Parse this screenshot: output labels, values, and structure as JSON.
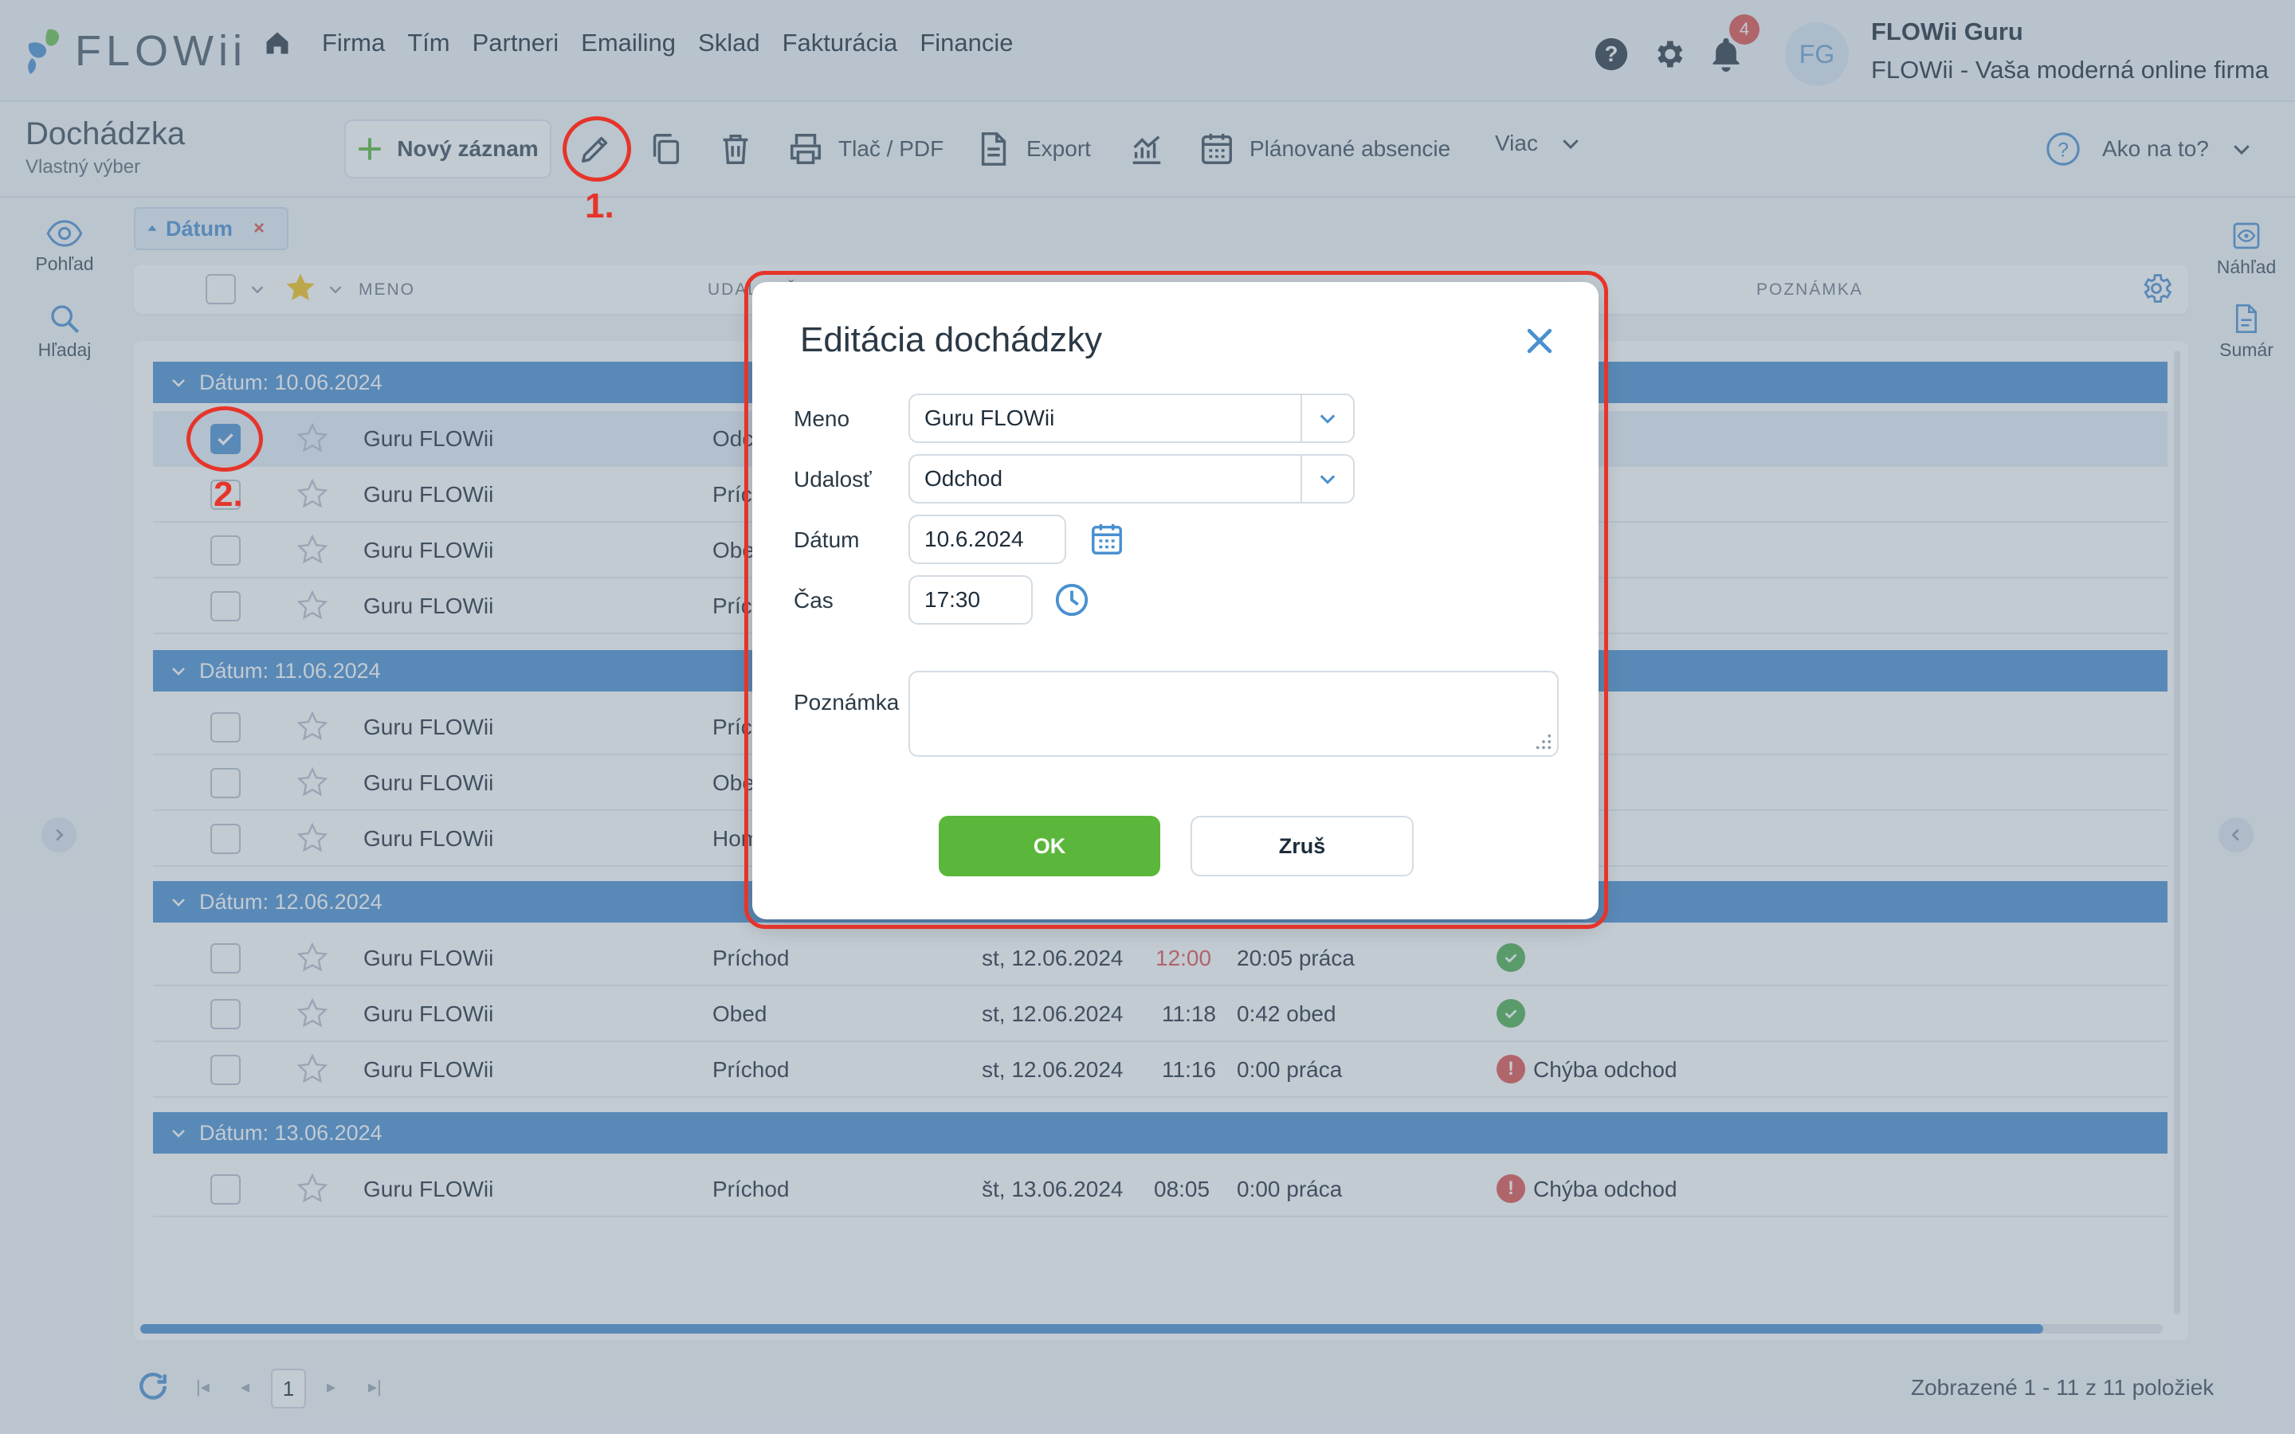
{
  "brand": {
    "logo_text": "FLOWii"
  },
  "nav": {
    "items": [
      "Firma",
      "Tím",
      "Partneri",
      "Emailing",
      "Sklad",
      "Fakturácia",
      "Financie"
    ]
  },
  "user": {
    "notifications": "4",
    "initials": "FG",
    "name": "FLOWii Guru",
    "company": "FLOWii - Vaša moderná online firma"
  },
  "page": {
    "title": "Dochádzka",
    "subtitle": "Vlastný výber"
  },
  "toolbar": {
    "new_record": "Nový záznam",
    "print": "Tlač / PDF",
    "export": "Export",
    "planned_absences": "Plánované absencie",
    "more": "Viac",
    "howto": "Ako na to?"
  },
  "rail_left": {
    "view": "Pohľad",
    "search": "Hľadaj"
  },
  "rail_right": {
    "preview": "Náhľad",
    "summary": "Sumár"
  },
  "filter_chip": {
    "label": "Dátum"
  },
  "table_header": {
    "name": "MENO",
    "event": "UDALOSŤ",
    "note": "POZNÁMKA"
  },
  "groups": [
    {
      "label": "Dátum: 10.06.2024",
      "rows": [
        {
          "name": "Guru FLOWii",
          "event": "Odchod",
          "selected": true
        },
        {
          "name": "Guru FLOWii",
          "event": "Príchod"
        },
        {
          "name": "Guru FLOWii",
          "event": "Obed"
        },
        {
          "name": "Guru FLOWii",
          "event": "Príchod"
        }
      ]
    },
    {
      "label": "Dátum: 11.06.2024",
      "rows": [
        {
          "name": "Guru FLOWii",
          "event": "Príchod"
        },
        {
          "name": "Guru FLOWii",
          "event": "Obed"
        },
        {
          "name": "Guru FLOWii",
          "event": "Home office"
        }
      ]
    },
    {
      "label": "Dátum: 12.06.2024",
      "rows": [
        {
          "name": "Guru FLOWii",
          "event": "Príchod",
          "date": "st, 12.06.2024",
          "time": "12:00",
          "duration": "20:05 práca",
          "status": "ok",
          "time_color": "#e0524d"
        },
        {
          "name": "Guru FLOWii",
          "event": "Obed",
          "date": "st, 12.06.2024",
          "time": "11:18",
          "duration": "0:42 obed",
          "status": "ok"
        },
        {
          "name": "Guru FLOWii",
          "event": "Príchod",
          "date": "st, 12.06.2024",
          "time": "11:16",
          "duration": "0:00 práca",
          "status": "error",
          "note": "Chýba odchod"
        }
      ]
    },
    {
      "label": "Dátum: 13.06.2024",
      "rows": [
        {
          "name": "Guru FLOWii",
          "event": "Príchod",
          "date": "št, 13.06.2024",
          "time": "08:05",
          "duration": "0:00 práca",
          "status": "error",
          "note": "Chýba odchod"
        }
      ]
    }
  ],
  "pager": {
    "current_page": "1",
    "info": "Zobrazené 1 - 11 z 11 položiek"
  },
  "dialog": {
    "title": "Editácia dochádzky",
    "name_label": "Meno",
    "name_value": "Guru FLOWii",
    "event_label": "Udalosť",
    "event_value": "Odchod",
    "date_label": "Dátum",
    "date_value": "10.6.2024",
    "time_label": "Čas",
    "time_value": "17:30",
    "note_label": "Poznámka",
    "note_value": "",
    "ok_label": "OK",
    "cancel_label": "Zruš"
  },
  "annotations": {
    "step1": "1.",
    "step2": "2."
  },
  "colors": {
    "accent": "#4a90d0",
    "ok_green": "#5bb73b",
    "annotation_red": "#e5352b"
  }
}
